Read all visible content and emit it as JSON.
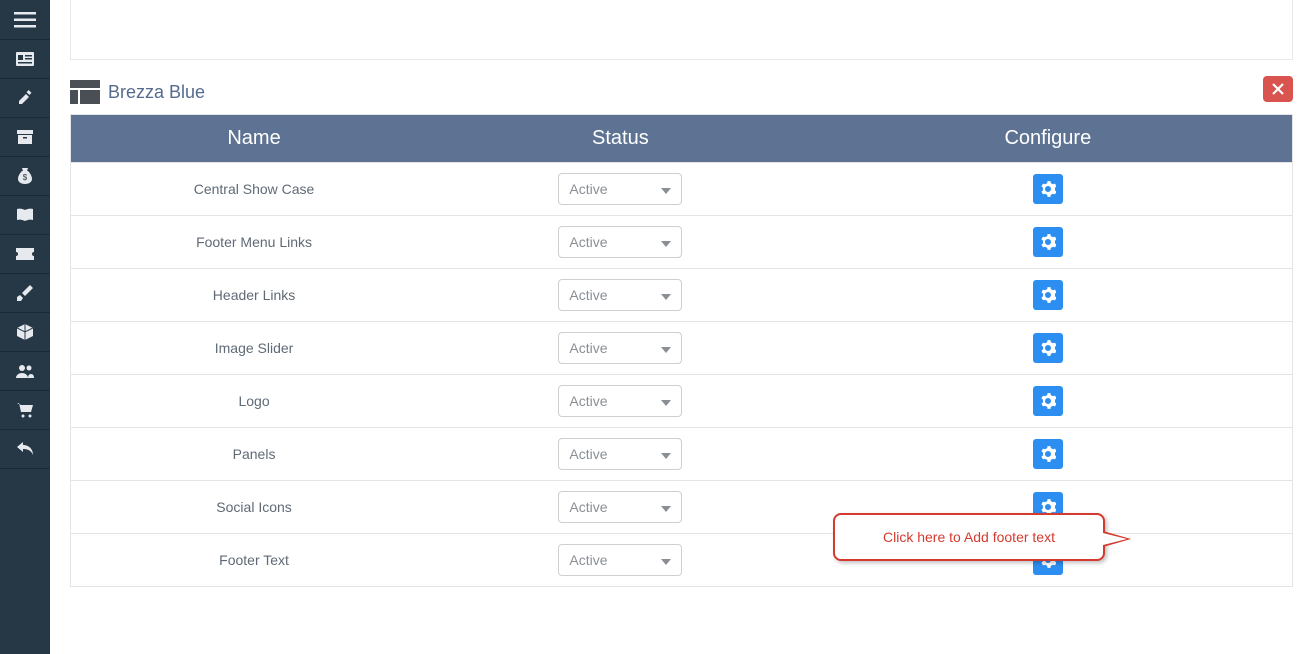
{
  "sidebar": {
    "items": [
      "menu",
      "card",
      "edit",
      "archive",
      "money",
      "book",
      "ticket",
      "paint",
      "box",
      "users",
      "cart",
      "undo"
    ]
  },
  "panel": {
    "title": "Brezza Blue",
    "columns": {
      "name": "Name",
      "status": "Status",
      "configure": "Configure"
    },
    "rows": [
      {
        "name": "Central Show Case",
        "status": "Active"
      },
      {
        "name": "Footer Menu Links",
        "status": "Active"
      },
      {
        "name": "Header Links",
        "status": "Active"
      },
      {
        "name": "Image Slider",
        "status": "Active"
      },
      {
        "name": "Logo",
        "status": "Active"
      },
      {
        "name": "Panels",
        "status": "Active"
      },
      {
        "name": "Social Icons",
        "status": "Active"
      },
      {
        "name": "Footer Text",
        "status": "Active"
      }
    ]
  },
  "callout": {
    "text": "Click here to Add footer text"
  }
}
